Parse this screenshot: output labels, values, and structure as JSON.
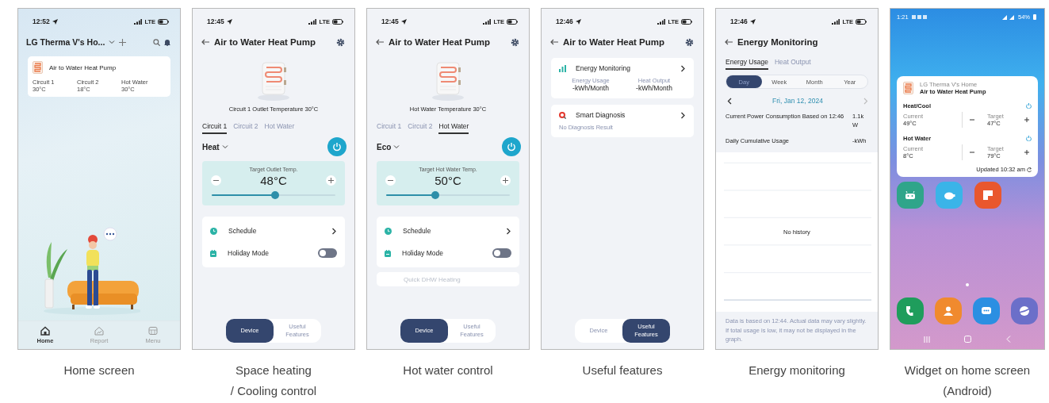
{
  "screens": [
    {
      "kind": "home",
      "caption": "Home screen",
      "status": {
        "time": "12:52",
        "network": "LTE"
      },
      "title": "LG Therma V's Ho...",
      "device": {
        "name": "Air to Water Heat Pump",
        "readings": [
          {
            "label": "Circuit 1",
            "value": "30°C"
          },
          {
            "label": "Circuit 2",
            "value": "18°C"
          },
          {
            "label": "Hot Water",
            "value": "30°C"
          }
        ]
      },
      "nav": [
        {
          "label": "Home",
          "selected": true
        },
        {
          "label": "Report",
          "selected": false
        },
        {
          "label": "Menu",
          "selected": false
        }
      ]
    },
    {
      "kind": "control",
      "caption": "Space heating\n/ Cooling control",
      "status": {
        "time": "12:45",
        "network": "LTE"
      },
      "title": "Air to Water Heat Pump",
      "product_caption": "Circuit 1 Outlet Temperature 30°C",
      "tabs": [
        {
          "label": "Circuit 1",
          "selected": true
        },
        {
          "label": "Circuit 2",
          "selected": false
        },
        {
          "label": "Hot Water",
          "selected": false
        }
      ],
      "mode": "Heat",
      "power_on": true,
      "target": {
        "label": "Target Outlet Temp.",
        "value": "48°C",
        "level": 0.51
      },
      "rows": [
        {
          "kind": "link",
          "label": "Schedule",
          "disabled": false
        },
        {
          "kind": "toggle",
          "label": "Holiday Mode",
          "on": false,
          "disabled": false
        }
      ],
      "segments": [
        {
          "label": "Device",
          "selected": true
        },
        {
          "label": "Useful\nFeatures",
          "selected": false
        }
      ]
    },
    {
      "kind": "control",
      "caption": "Hot water control",
      "status": {
        "time": "12:45",
        "network": "LTE"
      },
      "title": "Air to Water Heat Pump",
      "product_caption": "Hot Water Temperature 30°C",
      "tabs": [
        {
          "label": "Circuit 1",
          "selected": false
        },
        {
          "label": "Circuit 2",
          "selected": false
        },
        {
          "label": "Hot Water",
          "selected": true
        }
      ],
      "mode": "Eco",
      "power_on": true,
      "target": {
        "label": "Target Hot Water Temp.",
        "value": "50°C",
        "level": 0.4
      },
      "rows": [
        {
          "kind": "link",
          "label": "Schedule",
          "disabled": false
        },
        {
          "kind": "toggle",
          "label": "Holiday Mode",
          "on": false,
          "disabled": false
        },
        {
          "kind": "action",
          "label": "Quick DHW Heating",
          "disabled": true
        }
      ],
      "segments": [
        {
          "label": "Device",
          "selected": true
        },
        {
          "label": "Useful\nFeatures",
          "selected": false
        }
      ]
    },
    {
      "kind": "features",
      "caption": "Useful features",
      "status": {
        "time": "12:46",
        "network": "LTE"
      },
      "title": "Air to Water Heat Pump",
      "cards": [
        {
          "kind": "energy",
          "title": "Energy Monitoring",
          "stats": [
            {
              "label": "Energy Usage",
              "value": "-kWh/Month"
            },
            {
              "label": "Heat Output",
              "value": "-kWh/Month"
            }
          ]
        },
        {
          "kind": "diagnosis",
          "title": "Smart Diagnosis",
          "note": "No Diagnosis Result"
        }
      ],
      "segments": [
        {
          "label": "Device",
          "selected": false
        },
        {
          "label": "Useful\nFeatures",
          "selected": true
        }
      ]
    },
    {
      "kind": "energy",
      "caption": "Energy monitoring",
      "status": {
        "time": "12:46",
        "network": "LTE"
      },
      "title": "Energy Monitoring",
      "tabs": [
        {
          "label": "Energy Usage",
          "selected": true
        },
        {
          "label": "Heat Output",
          "selected": false
        }
      ],
      "periods": [
        {
          "label": "Day",
          "selected": true
        },
        {
          "label": "Week",
          "selected": false
        },
        {
          "label": "Month",
          "selected": false
        },
        {
          "label": "Year",
          "selected": false
        }
      ],
      "date": "Fri, Jan 12, 2024",
      "rows": [
        {
          "label": "Current Power Consumption Based on 12:46",
          "value": "1.1k W"
        },
        {
          "label": "Daily Cumulative Usage",
          "value": "-kWh"
        }
      ],
      "chart_message": "No history",
      "footnote": "Data is based on 12:44. Actual data may vary slightly. If total usage is low, it may not be displayed in the graph."
    },
    {
      "kind": "widget",
      "caption": "Widget on home screen\n(Android)",
      "status": {
        "time": "1:21",
        "battery": "54%"
      },
      "widget": {
        "home": "LG Therma V's Home",
        "device": "Air to Water Heat Pump",
        "updated": "Updated 10:32 am",
        "sections": [
          {
            "name": "Heat/Cool",
            "current_label": "Current",
            "current": "49°C",
            "target_label": "Target",
            "target": "47°C"
          },
          {
            "name": "Hot Water",
            "current_label": "Current",
            "current": "8°C",
            "target_label": "Target",
            "target": "79°C"
          }
        ]
      },
      "apps": [
        {
          "color": "#2fa58a"
        },
        {
          "color": "#3ab4e8"
        },
        {
          "color": "#e9572e"
        }
      ],
      "dock": [
        {
          "color": "#1f9d5c"
        },
        {
          "color": "#f08a2e"
        },
        {
          "color": "#2b8fe2"
        },
        {
          "color": "#6b6fc9"
        }
      ]
    }
  ]
}
